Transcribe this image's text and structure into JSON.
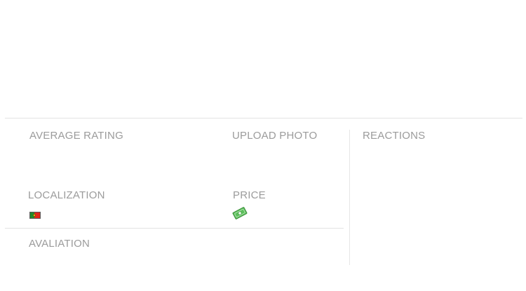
{
  "sections": {
    "average_rating": "AVERAGE RATING",
    "upload_photo": "UPLOAD PHOTO",
    "reactions": "REACTIONS",
    "localization": "LOCALIZATION",
    "price": "PRICE",
    "avaliation": "AVALIATION"
  },
  "icons": {
    "localization_flag": "portugal-flag-icon",
    "price_icon": "money-icon"
  },
  "colors": {
    "label": "#9b9b9b",
    "divider": "#e3e3e3",
    "money_green": "#5cbf5b"
  }
}
